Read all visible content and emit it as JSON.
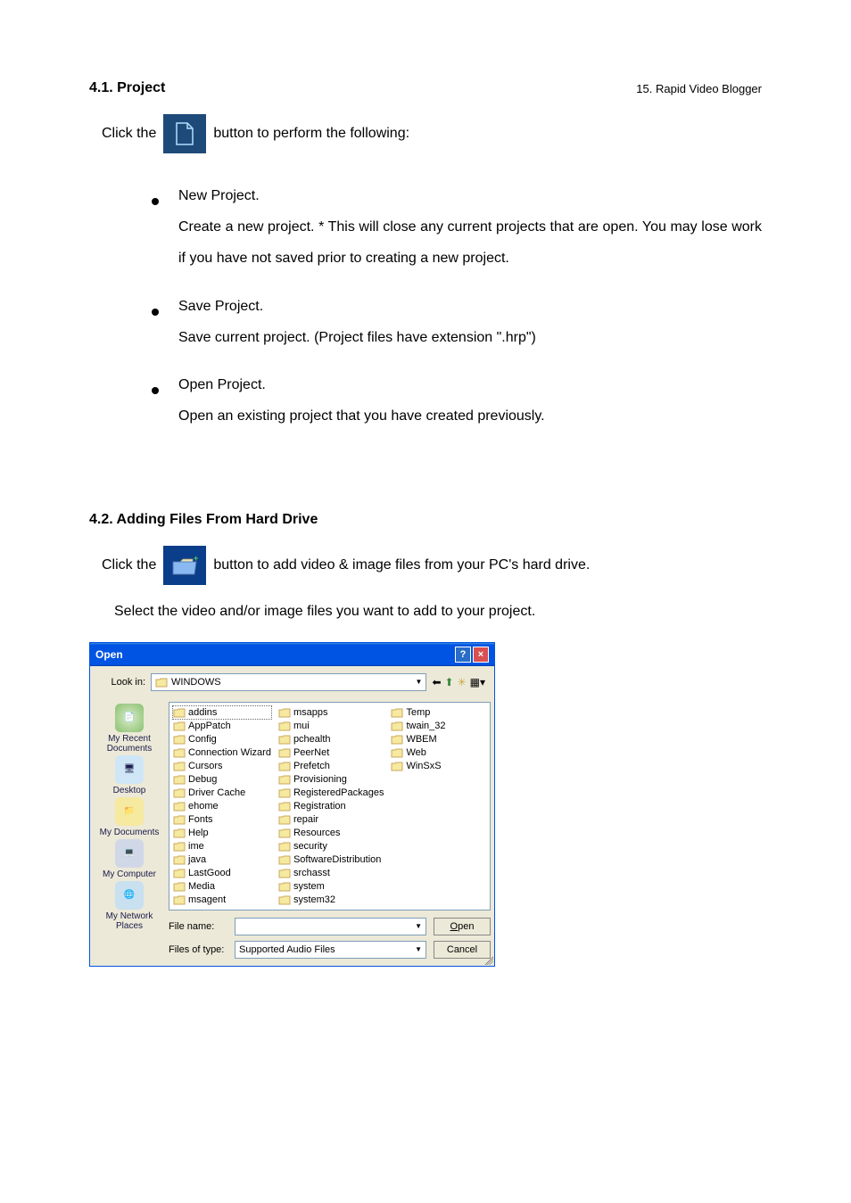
{
  "header": {
    "right": "15. Rapid Video Blogger"
  },
  "sec1": {
    "title": "4.1. Project",
    "click_before": "Click the",
    "click_after": "button to perform the following:",
    "bullets": [
      {
        "title": "New Project.",
        "body": "Create a new project.  * This will close any current projects that are open.  You may lose work if you have not saved prior to creating a new project."
      },
      {
        "title": "Save Project.",
        "body": "Save current project.  (Project files have extension \".hrp\")"
      },
      {
        "title": "Open Project.",
        "body": "Open an existing project that you have created previously."
      }
    ]
  },
  "sec2": {
    "title": "4.2. Adding Files From Hard Drive",
    "click_before": "Click the",
    "click_after": "button to add video & image files from your PC's hard drive.",
    "line2": "Select the video and/or image files you want to add to your project."
  },
  "dialog": {
    "title": "Open",
    "lookin_label": "Look in:",
    "lookin_value": "WINDOWS",
    "sidebar": [
      "My Recent Documents",
      "Desktop",
      "My Documents",
      "My Computer",
      "My Network Places"
    ],
    "cols": [
      [
        "addins",
        "AppPatch",
        "Config",
        "Connection Wizard",
        "Cursors",
        "Debug",
        "Driver Cache",
        "ehome",
        "Fonts",
        "Help",
        "ime",
        "java",
        "LastGood",
        "Media",
        "msagent"
      ],
      [
        "msapps",
        "mui",
        "pchealth",
        "PeerNet",
        "Prefetch",
        "Provisioning",
        "RegisteredPackages",
        "Registration",
        "repair",
        "Resources",
        "security",
        "SoftwareDistribution",
        "srchasst",
        "system",
        "system32"
      ],
      [
        "Temp",
        "twain_32",
        "WBEM",
        "Web",
        "WinSxS"
      ]
    ],
    "filename_label": "File name:",
    "filename_value": "",
    "filetype_label": "Files of type:",
    "filetype_value": "Supported Audio Files",
    "open_btn": "Open",
    "cancel_btn": "Cancel"
  }
}
